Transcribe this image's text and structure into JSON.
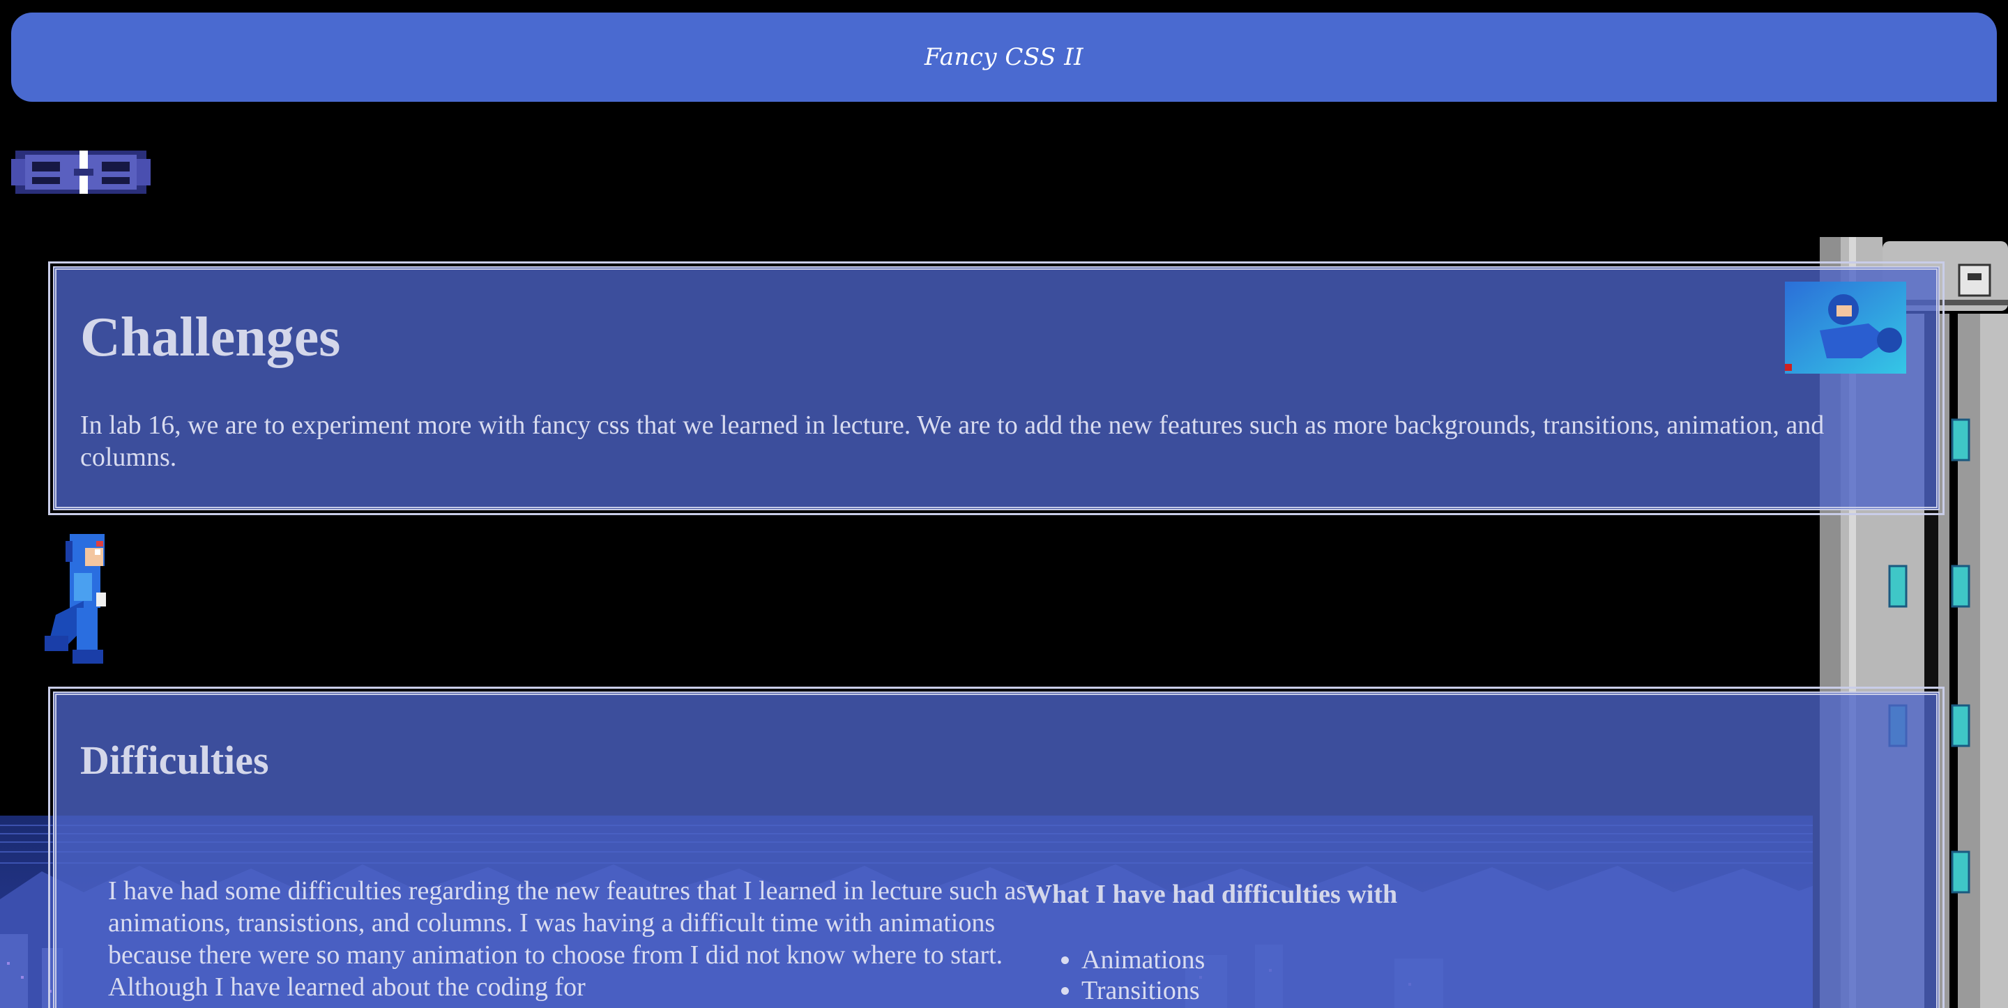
{
  "header": {
    "title": "Fancy CSS II"
  },
  "challenges": {
    "heading": "Challenges",
    "text": "In lab 16, we are to experiment more with fancy css that we learned in lecture. We are to add the new features such as more backgrounds, transitions, animation, and columns."
  },
  "difficulties": {
    "heading": "Difficulties",
    "paragraph": "I have had some difficulties regarding the new feautres that I learned in lecture such as animations, transistions, and columns. I was having a difficult time with animations because there were so many animation to choose from I did not know where to start. Although I have learned about the coding for",
    "list_heading": "What I have had difficulties with",
    "list_items": [
      "Animations",
      "Transitions"
    ]
  },
  "colors": {
    "banner": "#4a6ad0",
    "panel": "#4d64c8",
    "background": "#000000",
    "text": "#d9dcf0"
  },
  "icons": [
    "hover-vehicle-sprite",
    "megaman-thumbnail",
    "megaman-running-sprite",
    "city-skyline-background",
    "tower-background"
  ]
}
